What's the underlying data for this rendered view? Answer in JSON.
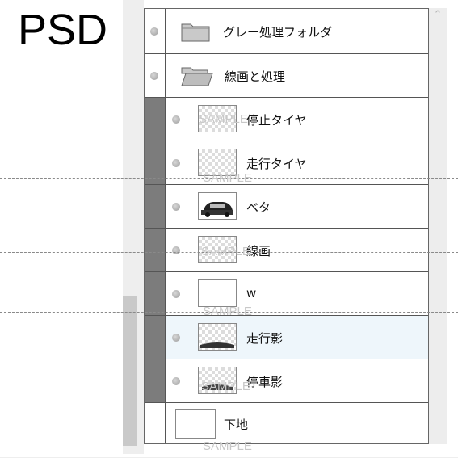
{
  "title": "PSD",
  "watermark": "SAMPLE",
  "layers": [
    {
      "name": "グレー処理フォルダ",
      "type": "folder-closed"
    },
    {
      "name": "線画と処理",
      "type": "folder-open"
    },
    {
      "name": "停止タイヤ",
      "type": "layer"
    },
    {
      "name": "走行タイヤ",
      "type": "layer"
    },
    {
      "name": "ベタ",
      "type": "layer"
    },
    {
      "name": "線画",
      "type": "layer"
    },
    {
      "name": "w",
      "type": "layer"
    },
    {
      "name": "走行影",
      "type": "layer",
      "selected": true
    },
    {
      "name": "停車影",
      "type": "layer"
    },
    {
      "name": "下地",
      "type": "background"
    }
  ],
  "icons": {
    "visibility": "eye-icon",
    "folder_closed": "folder-icon",
    "folder_open": "folder-open-icon",
    "scroll_up": "chevron-up-icon"
  },
  "colors": {
    "clip_bar": "#7c7c7c",
    "selected_row": "#eef6fb",
    "border": "#555555"
  }
}
